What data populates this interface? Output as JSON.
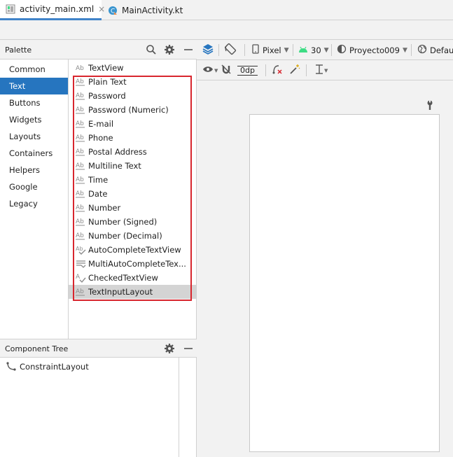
{
  "tabs": [
    {
      "label": "activity_main.xml",
      "close": "×"
    },
    {
      "label": "MainActivity.kt"
    }
  ],
  "palette": {
    "title": "Palette",
    "categories": [
      "Common",
      "Text",
      "Buttons",
      "Widgets",
      "Layouts",
      "Containers",
      "Helpers",
      "Google",
      "Legacy"
    ],
    "selected_category": "Text",
    "items": [
      {
        "label": "TextView",
        "icon": "ab-icon"
      },
      {
        "label": "Plain Text",
        "icon": "ab-underline-icon"
      },
      {
        "label": "Password",
        "icon": "ab-underline-icon"
      },
      {
        "label": "Password (Numeric)",
        "icon": "ab-underline-icon"
      },
      {
        "label": "E-mail",
        "icon": "ab-underline-icon"
      },
      {
        "label": "Phone",
        "icon": "ab-underline-icon"
      },
      {
        "label": "Postal Address",
        "icon": "ab-underline-icon"
      },
      {
        "label": "Multiline Text",
        "icon": "ab-underline-icon"
      },
      {
        "label": "Time",
        "icon": "ab-underline-icon"
      },
      {
        "label": "Date",
        "icon": "ab-underline-icon"
      },
      {
        "label": "Number",
        "icon": "ab-underline-icon"
      },
      {
        "label": "Number (Signed)",
        "icon": "ab-underline-icon"
      },
      {
        "label": "Number (Decimal)",
        "icon": "ab-underline-icon"
      },
      {
        "label": "AutoCompleteTextView",
        "icon": "ab-check-icon"
      },
      {
        "label": "MultiAutoCompleteTex...",
        "icon": "multi-lines-icon"
      },
      {
        "label": "CheckedTextView",
        "icon": "checked-text-icon"
      },
      {
        "label": "TextInputLayout",
        "icon": "ab-underline-icon"
      }
    ],
    "selected_item": "TextInputLayout"
  },
  "component_tree": {
    "title": "Component Tree",
    "root": "ConstraintLayout"
  },
  "design_toolbar": {
    "device": "Pixel",
    "api": "30",
    "theme": "Proyecto009",
    "locale": "Defaul",
    "margin": "0dp"
  },
  "colors": {
    "accent": "#2675bf",
    "highlight_box": "#d8262e",
    "android_green": "#3ddc84"
  }
}
